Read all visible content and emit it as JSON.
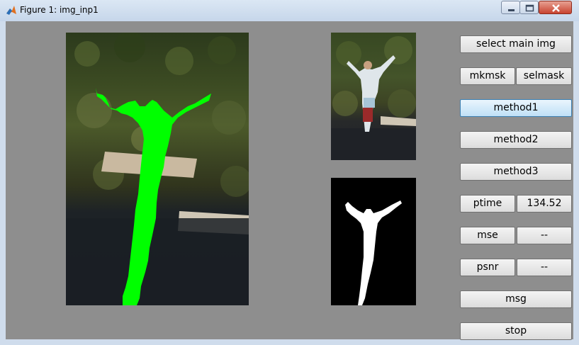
{
  "window": {
    "title": "Figure 1: img_inp1",
    "icon": "matlab-icon",
    "controls": [
      "minimize-icon",
      "maximize-icon",
      "close-icon"
    ],
    "background_color": "#8e8e8e"
  },
  "buttons": {
    "select_main": "select main img",
    "mkmsk": "mkmsk",
    "selmask": "selmask",
    "method1": "method1",
    "method2": "method2",
    "method3": "method3",
    "ptime": "ptime",
    "mse": "mse",
    "psnr": "psnr",
    "msg": "msg",
    "stop": "stop"
  },
  "values": {
    "ptime": "134.52",
    "mse": "--",
    "psnr": "--"
  },
  "colors": {
    "mask_green": "#00ff00",
    "mask_white": "#ffffff"
  }
}
